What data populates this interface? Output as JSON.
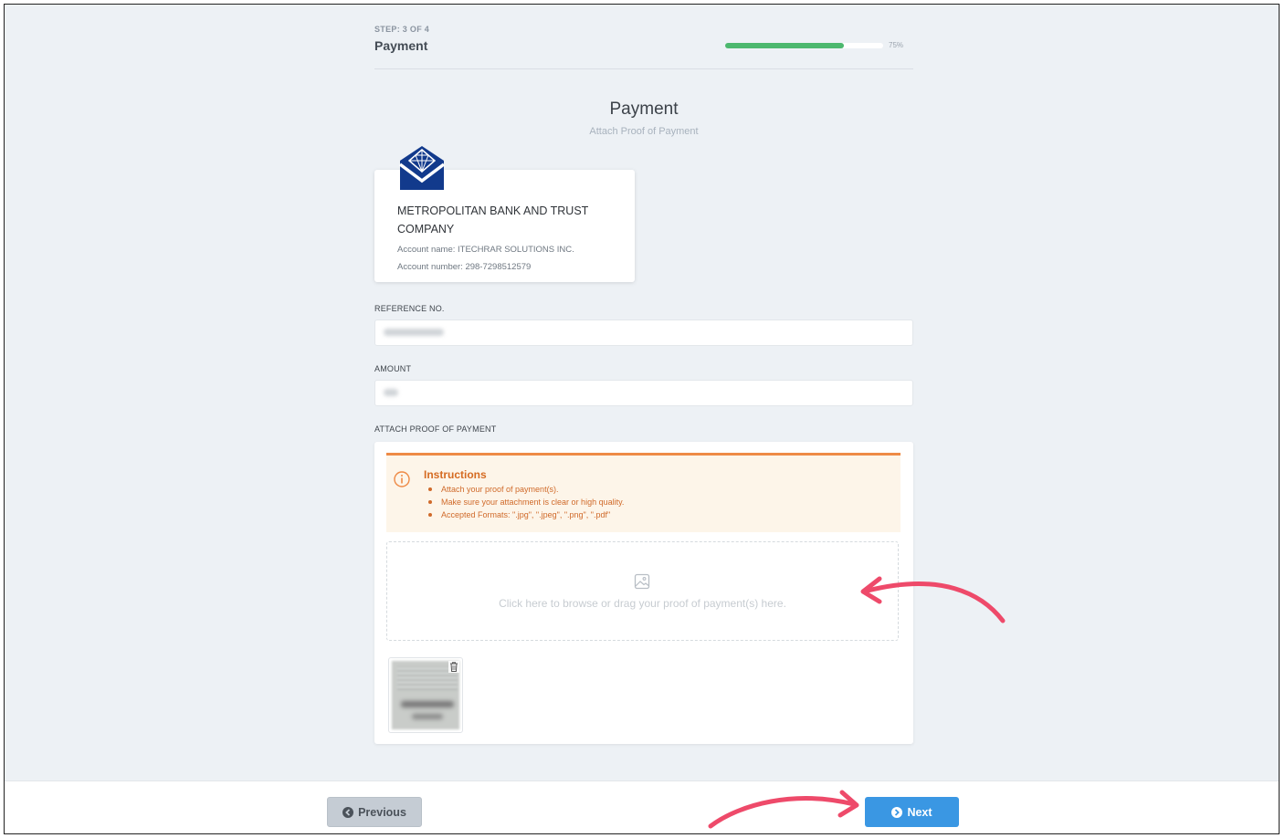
{
  "header": {
    "step_label": "STEP: 3 OF 4",
    "step_title": "Payment",
    "progress_percent": 75,
    "progress_label": "75%"
  },
  "page": {
    "title": "Payment",
    "subtitle": "Attach Proof of Payment"
  },
  "bank": {
    "name": "METROPOLITAN BANK AND TRUST COMPANY",
    "account_name": "Account name: ITECHRAR SOLUTIONS INC.",
    "account_number": "Account number: 298-7298512579",
    "logo_icon": "bank-envelope-diamond-icon",
    "logo_color": "#123a8c"
  },
  "form": {
    "reference_label": "REFERENCE NO.",
    "amount_label": "AMOUNT",
    "attach_label": "ATTACH PROOF OF PAYMENT"
  },
  "instructions": {
    "title": "Instructions",
    "items": [
      "Attach your proof of payment(s).",
      "Make sure your attachment is clear or high quality.",
      "Accepted Formats: \".jpg\", \".jpeg\", \".png\", \".pdf\""
    ],
    "accent_color": "#ee8a46"
  },
  "dropzone": {
    "text": "Click here to browse or drag your proof of payment(s) here.",
    "icon": "image-icon"
  },
  "attachment": {
    "delete_icon": "trash-icon"
  },
  "footer": {
    "previous_label": "Previous",
    "next_label": "Next",
    "previous_icon": "arrow-left-circle-icon",
    "next_icon": "arrow-right-circle-icon"
  },
  "annotations": {
    "arrow_color": "#ee4a6a"
  }
}
